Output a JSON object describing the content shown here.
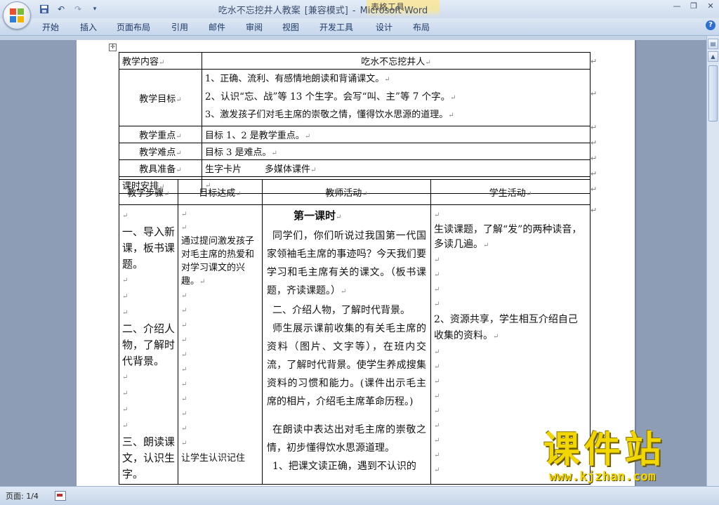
{
  "window": {
    "title": [
      "吃水不忘挖井人教案",
      "[兼容模式]",
      "-",
      "Microsoft Word"
    ],
    "context_tab_group": "表格工具",
    "controls": [
      "minimize",
      "restore",
      "close"
    ]
  },
  "quick_access": {
    "icons": [
      "save-icon",
      "undo-icon",
      "redo-icon",
      "customize-icon"
    ]
  },
  "ribbon": {
    "tabs": [
      "开始",
      "插入",
      "页面布局",
      "引用",
      "邮件",
      "审阅",
      "视图",
      "开发工具",
      "设计",
      "布局"
    ]
  },
  "paragraph_mark": "↵",
  "table1": {
    "row1": {
      "label": "教学内容",
      "value": "吃水不忘挖井人"
    },
    "row2": {
      "label": "教学目标",
      "lines": [
        "1、正确、流利、有感情地朗读和背诵课文。",
        "2、认识“忘、战”等 13 个生字。会写“叫、主”等 7 个字。",
        "3、激发孩子们对毛主席的崇敬之情，懂得饮水思源的道理。"
      ]
    },
    "row3": {
      "label": "教学重点",
      "value": "目标 1、2 是教学重点。"
    },
    "row4": {
      "label": "教学难点",
      "value": "目标 3 是难点。"
    },
    "row5": {
      "label": "教具准备",
      "value": "生字卡片        多媒体课件"
    },
    "row6": {
      "label": "课时安排",
      "value": ""
    }
  },
  "table2": {
    "headers": [
      "教学步骤",
      "目标达成",
      "教师活动",
      "学生活动"
    ],
    "steps": [
      "一、导入新课，板书课题。",
      "二、介绍人物，了解时代背景。",
      "三、朗读课文，认识生字。"
    ],
    "goal": "通过提问激发孩子对毛主席的热爱和对学习课文的兴趣。",
    "goal_cutoff": "让学生认识记住",
    "teacher": {
      "heading": "第一课时",
      "p1": "同学们，你们听说过我国第一代国家领袖毛主席的事迹吗？今天我们要学习和毛主席有关的课文。（板书课题，齐读课题。）",
      "p2": "二、介绍人物，了解时代背景。",
      "p3": "师生展示课前收集的有关毛主席的资料（图片、文字等），在班内交流，了解时代背景。使学生养成搜集资料的习惯和能力。(课件出示毛主席的相片，介绍毛主席革命历程。)",
      "p4": "在朗读中表达出对毛主席的崇敬之情，初步懂得饮水思源道理。",
      "p5": "1、把课文读正确，遇到不认识的"
    },
    "student": {
      "s1": "生读课题，了解“发”的两种读音，多读几遍。",
      "s2": "2、资源共享，学生相互介绍自己收集的资料。"
    }
  },
  "status": {
    "page": "页面: 1/4"
  },
  "watermark": {
    "main": "课件站",
    "url": "www.kjzhan.com"
  }
}
